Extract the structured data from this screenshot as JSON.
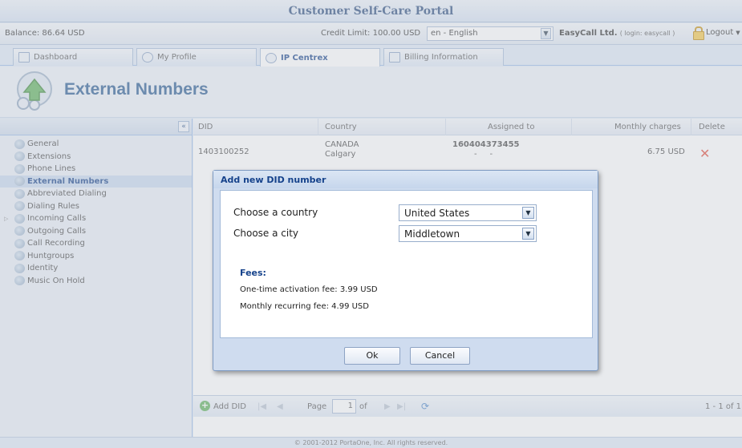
{
  "app": {
    "title": "Customer Self-Care Portal"
  },
  "info": {
    "balance": "Balance: 86.64 USD",
    "credit": "Credit Limit: 100.00 USD",
    "language": "en - English",
    "account": "EasyCall Ltd.",
    "login": "( login: easycall )",
    "logout": "Logout"
  },
  "tabs": [
    {
      "label": "Dashboard"
    },
    {
      "label": "My Profile"
    },
    {
      "label": "IP Centrex"
    },
    {
      "label": "Billing Information"
    }
  ],
  "page": {
    "title": "External Numbers"
  },
  "sidebar": {
    "items": [
      {
        "label": "General"
      },
      {
        "label": "Extensions"
      },
      {
        "label": "Phone Lines"
      },
      {
        "label": "External Numbers"
      },
      {
        "label": "Abbreviated Dialing"
      },
      {
        "label": "Dialing Rules"
      },
      {
        "label": "Incoming Calls"
      },
      {
        "label": "Outgoing Calls"
      },
      {
        "label": "Call Recording"
      },
      {
        "label": "Huntgroups"
      },
      {
        "label": "Identity"
      },
      {
        "label": "Music On Hold"
      }
    ]
  },
  "grid": {
    "columns": [
      "DID",
      "Country",
      "Assigned to",
      "Monthly charges",
      "Delete"
    ],
    "rows": [
      {
        "did": "1403100252",
        "country": "CANADA",
        "city": "Calgary",
        "assigned": "160404373455",
        "assigned_sub": "-     -",
        "charges": "6.75 USD"
      }
    ],
    "footer": {
      "add": "Add DID",
      "page_label": "Page",
      "page": "1",
      "of": "of",
      "range": "1 - 1 of 1"
    }
  },
  "dialog": {
    "title": "Add new DID number",
    "country_label": "Choose a country",
    "country_value": "United States",
    "city_label": "Choose a city",
    "city_value": "Middletown",
    "fees_heading": "Fees:",
    "activation_fee": "One-time activation fee: 3.99 USD",
    "recurring_fee": "Monthly recurring fee: 4.99 USD",
    "ok": "Ok",
    "cancel": "Cancel"
  },
  "footer": {
    "copyright": "© 2001-2012 PortaOne, Inc. All rights reserved."
  }
}
